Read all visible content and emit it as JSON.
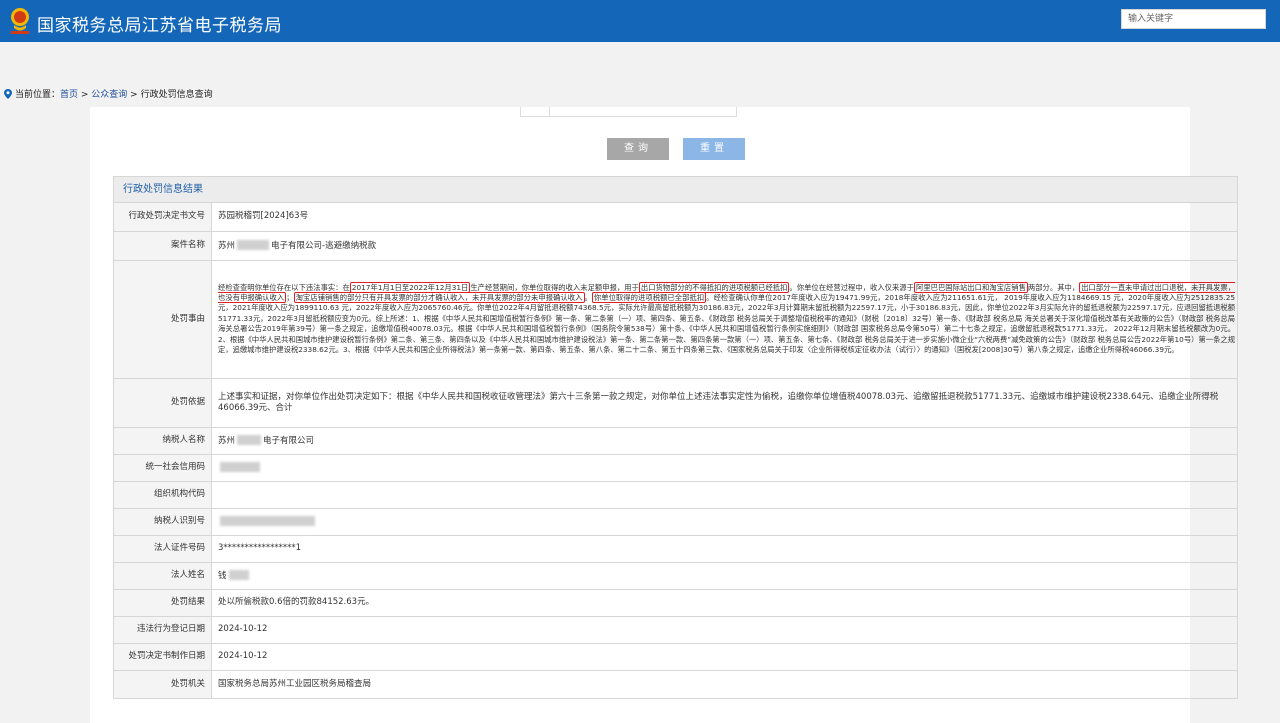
{
  "header": {
    "site_title": "国家税务总局江苏省电子税务局",
    "search_placeholder": "输入关键字"
  },
  "breadcrumb": {
    "label": "当前位置：",
    "home": "首页",
    "sep": " > ",
    "level1": "公众查询",
    "level2": "行政处罚信息查询"
  },
  "form": {
    "query_label": "查询",
    "reset_label": "重置"
  },
  "result": {
    "heading": "行政处罚信息结果",
    "rows": {
      "doc_no": {
        "label": "行政处罚决定书文号",
        "value": "苏园税稽罚[2024]63号"
      },
      "case_name": {
        "label": "案件名称",
        "prefix": "苏州",
        "suffix": "电子有限公司-逃避缴纳税款"
      },
      "reason": {
        "label": "处罚事由",
        "p1": "经检查查明你单位存在以下违法事实：在",
        "m1": "2017年1月1日至2022年12月31日",
        "p2": "生产经营期间，你单位取得的收入未足额申报，用于",
        "m2": "出口货物部分的不得抵扣的进项税额已经抵扣",
        "p3": "。你单位在经营过程中，收入仅来源于",
        "m3": "阿里巴巴国际站出口和淘宝店销售",
        "p4": "两部分。其中，",
        "m4": "出口部分一直未申请过出口退税，未开具发票，也没有申报确认收入",
        "p5": "；",
        "m5": "淘宝店铺销售的部分只有开具发票的部分才确认收入，未开具发票的部分未申报确认收入",
        "p6": "。",
        "m6": "你单位取得的进项税额已全部抵扣",
        "p7": "。经检查确认你单位2017年度收入应为19471.99元，2018年度收入应为211651.61元， 2019年度收入应为1184669.15 元，2020年度收入应为2512835.25 元，2021年度收入应为1899110.63 元，2022年度收入应为2065760.46元。你单位2022年4月留抵退税额74368.5元，实际允许最高留抵税额为30186.83元，2022年3月计算期末留抵税额为22597.17元，小于30186.83元，因此，你单位2022年3月实际允许的留抵退税额为22597.17元，应退回留抵退税额51771.33元，2022年3月留抵税额应变为0元。综上所述：1、根据《中华人民共和国增值税暂行条例》第一条、第二条第（一）项、第四条、第五条、《财政部 税务总局关于调整增值税税率的通知》（财税〔2018〕32号）第一条、《财政部 税务总局 海关总署关于深化增值税改革有关政策的公告》（财政部 税务总局 海关总署公告2019年第39号）第一条之规定，追缴增值税40078.03元。根据《中华人民共和国增值税暂行条例》（国务院令第538号）第十条、《中华人民共和国增值税暂行条例实施细则》（财政部 国家税务总局令第50号）第二十七条之规定，追缴留抵退税款51771.33元， 2022年12月期末留抵税额改为0元。2、根据《中华人民共和国城市维护建设税暂行条例》第二条、第三条、第四条以及《中华人民共和国城市维护建设税法》第一条、第二条第一款、第四条第一款第（一）项、第五条、第七条、《财政部 税务总局关于进一步实施小微企业“六税两费”减免政策的公告》（财政部 税务总局公告2022年第10号）第一条之规定，追缴城市维护建设税2338.62元。3、根据《中华人民共和国企业所得税法》第一条第一款、第四条、第五条、第八条、第二十二条、第五十四条第三款、《国家税务总局关于印发〈企业所得税核定征收办法（试行）〉的通知》（国税发[2008]30号）第八条之规定，追缴企业所得税46066.39元。"
      },
      "basis": {
        "label": "处罚依据",
        "value": "上述事实和证据，对你单位作出处罚决定如下：根据《中华人民共和国税收征收管理法》第六十三条第一款之规定，对你单位上述违法事实定性为偷税，追缴你单位增值税40078.03元、追缴留抵退税款51771.33元、追缴城市维护建设税2338.64元、追缴企业所得税46066.39元、合计"
      },
      "taxpayer_name": {
        "label": "纳税人名称",
        "prefix": "苏州",
        "suffix": "电子有限公司"
      },
      "credit_code": {
        "label": "统一社会信用码"
      },
      "org_code": {
        "label": "组织机构代码"
      },
      "taxpayer_id": {
        "label": "纳税人识别号"
      },
      "legal_id": {
        "label": "法人证件号码",
        "value": "3*****************1"
      },
      "legal_name": {
        "label": "法人姓名",
        "value": "钱"
      },
      "penalty_result": {
        "label": "处罚结果",
        "value": "处以所偷税款0.6倍的罚款84152.63元。"
      },
      "violation_date": {
        "label": "违法行为登记日期",
        "value": "2024-10-12"
      },
      "decision_date": {
        "label": "处罚决定书制作日期",
        "value": "2024-10-12"
      },
      "authority": {
        "label": "处罚机关",
        "value": "国家税务总局苏州工业园区税务局稽查局"
      }
    }
  },
  "colors": {
    "header_bg": "#1467b8",
    "highlight": "#e02020",
    "link": "#1f4e9c"
  },
  "icons": {
    "logo": "tax-emblem-icon",
    "pin": "location-pin-icon"
  }
}
